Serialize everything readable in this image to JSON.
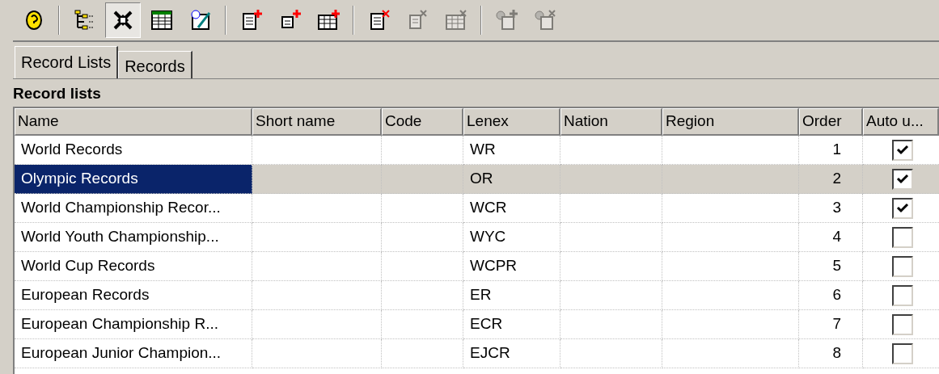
{
  "toolbar": [
    [
      {
        "disabled": false,
        "pressed": false
      }
    ],
    [
      {
        "disabled": false,
        "pressed": false
      },
      {
        "disabled": false,
        "pressed": true
      },
      {
        "disabled": false,
        "pressed": false
      },
      {
        "disabled": false,
        "pressed": false
      }
    ],
    [
      {
        "disabled": false,
        "pressed": false
      },
      {
        "disabled": false,
        "pressed": false
      },
      {
        "disabled": false,
        "pressed": false
      }
    ],
    [
      {
        "disabled": false,
        "pressed": false
      },
      {
        "disabled": true,
        "pressed": false
      },
      {
        "disabled": true,
        "pressed": false
      }
    ],
    [
      {
        "disabled": true,
        "pressed": false
      },
      {
        "disabled": true,
        "pressed": false
      }
    ]
  ],
  "tabs": [
    {
      "label": "Record Lists",
      "selected": true
    },
    {
      "label": "Records",
      "selected": false
    }
  ],
  "section_title": "Record lists",
  "table": {
    "columns": [
      "Name",
      "Short name",
      "Code",
      "Lenex",
      "Nation",
      "Region",
      "Order",
      "Auto u..."
    ],
    "rows": [
      {
        "name": "World Records",
        "lenex": "WR",
        "order": "1",
        "auto_update": true,
        "selected": false
      },
      {
        "name": "Olympic Records",
        "lenex": "OR",
        "order": "2",
        "auto_update": true,
        "selected": true
      },
      {
        "name": "World Championship Recor...",
        "lenex": "WCR",
        "order": "3",
        "auto_update": true,
        "selected": false
      },
      {
        "name": "World Youth Championship...",
        "lenex": "WYC",
        "order": "4",
        "auto_update": false,
        "selected": false
      },
      {
        "name": "World Cup Records",
        "lenex": "WCPR",
        "order": "5",
        "auto_update": false,
        "selected": false
      },
      {
        "name": "European Records",
        "lenex": "ER",
        "order": "6",
        "auto_update": false,
        "selected": false
      },
      {
        "name": "European Championship R...",
        "lenex": "ECR",
        "order": "7",
        "auto_update": false,
        "selected": false
      },
      {
        "name": "European Junior Champion...",
        "lenex": "EJCR",
        "order": "8",
        "auto_update": false,
        "selected": false
      }
    ]
  }
}
